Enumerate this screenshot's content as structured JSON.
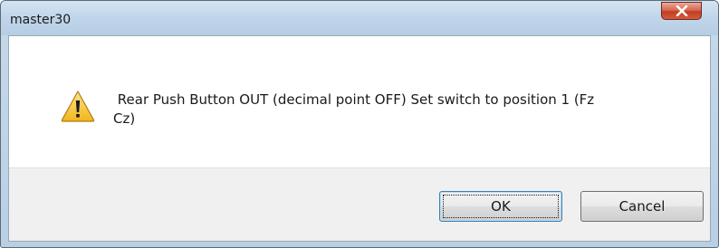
{
  "window": {
    "title": "master30"
  },
  "dialog": {
    "message": " Rear Push Button OUT (decimal point OFF) Set switch to position 1 (Fz\nCz)",
    "icon": "warning-icon"
  },
  "buttons": {
    "ok_label": "OK",
    "cancel_label": "Cancel"
  },
  "colors": {
    "close_button": "#c9452a",
    "warning_yellow": "#f5c531",
    "focus_border": "#3c7fb1"
  }
}
